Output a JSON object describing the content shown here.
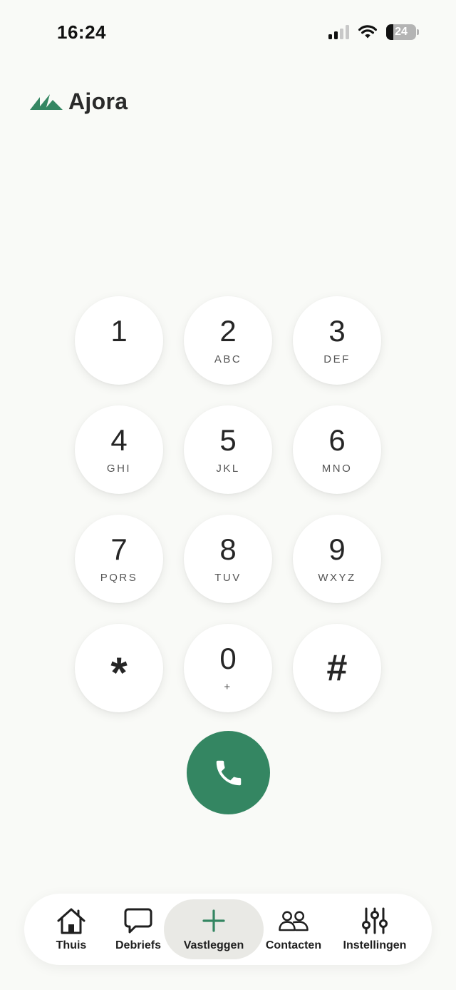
{
  "status_bar": {
    "time": "16:24",
    "battery_level": "24",
    "signal_bars_active": 2,
    "icons": [
      "signal-icon",
      "wifi-icon",
      "battery-icon"
    ]
  },
  "app": {
    "brand_name": "Ajora",
    "brand_color": "#348662"
  },
  "keypad": {
    "keys": [
      {
        "digit": "1",
        "letters": ""
      },
      {
        "digit": "2",
        "letters": "ABC"
      },
      {
        "digit": "3",
        "letters": "DEF"
      },
      {
        "digit": "4",
        "letters": "GHI"
      },
      {
        "digit": "5",
        "letters": "JKL"
      },
      {
        "digit": "6",
        "letters": "MNO"
      },
      {
        "digit": "7",
        "letters": "PQRS"
      },
      {
        "digit": "8",
        "letters": "TUV"
      },
      {
        "digit": "9",
        "letters": "WXYZ"
      },
      {
        "digit": "*",
        "letters": ""
      },
      {
        "digit": "0",
        "letters": "+"
      },
      {
        "digit": "#",
        "letters": ""
      }
    ],
    "call_icon": "phone-icon"
  },
  "bottom_nav": {
    "items": [
      {
        "label": "Thuis",
        "icon": "home-icon"
      },
      {
        "label": "Debriefs",
        "icon": "chat-bubble-icon"
      },
      {
        "label": "Vastleggen",
        "icon": "plus-icon",
        "active": true
      },
      {
        "label": "Contacten",
        "icon": "contacts-icon"
      },
      {
        "label": "Instellingen",
        "icon": "sliders-icon"
      }
    ]
  }
}
